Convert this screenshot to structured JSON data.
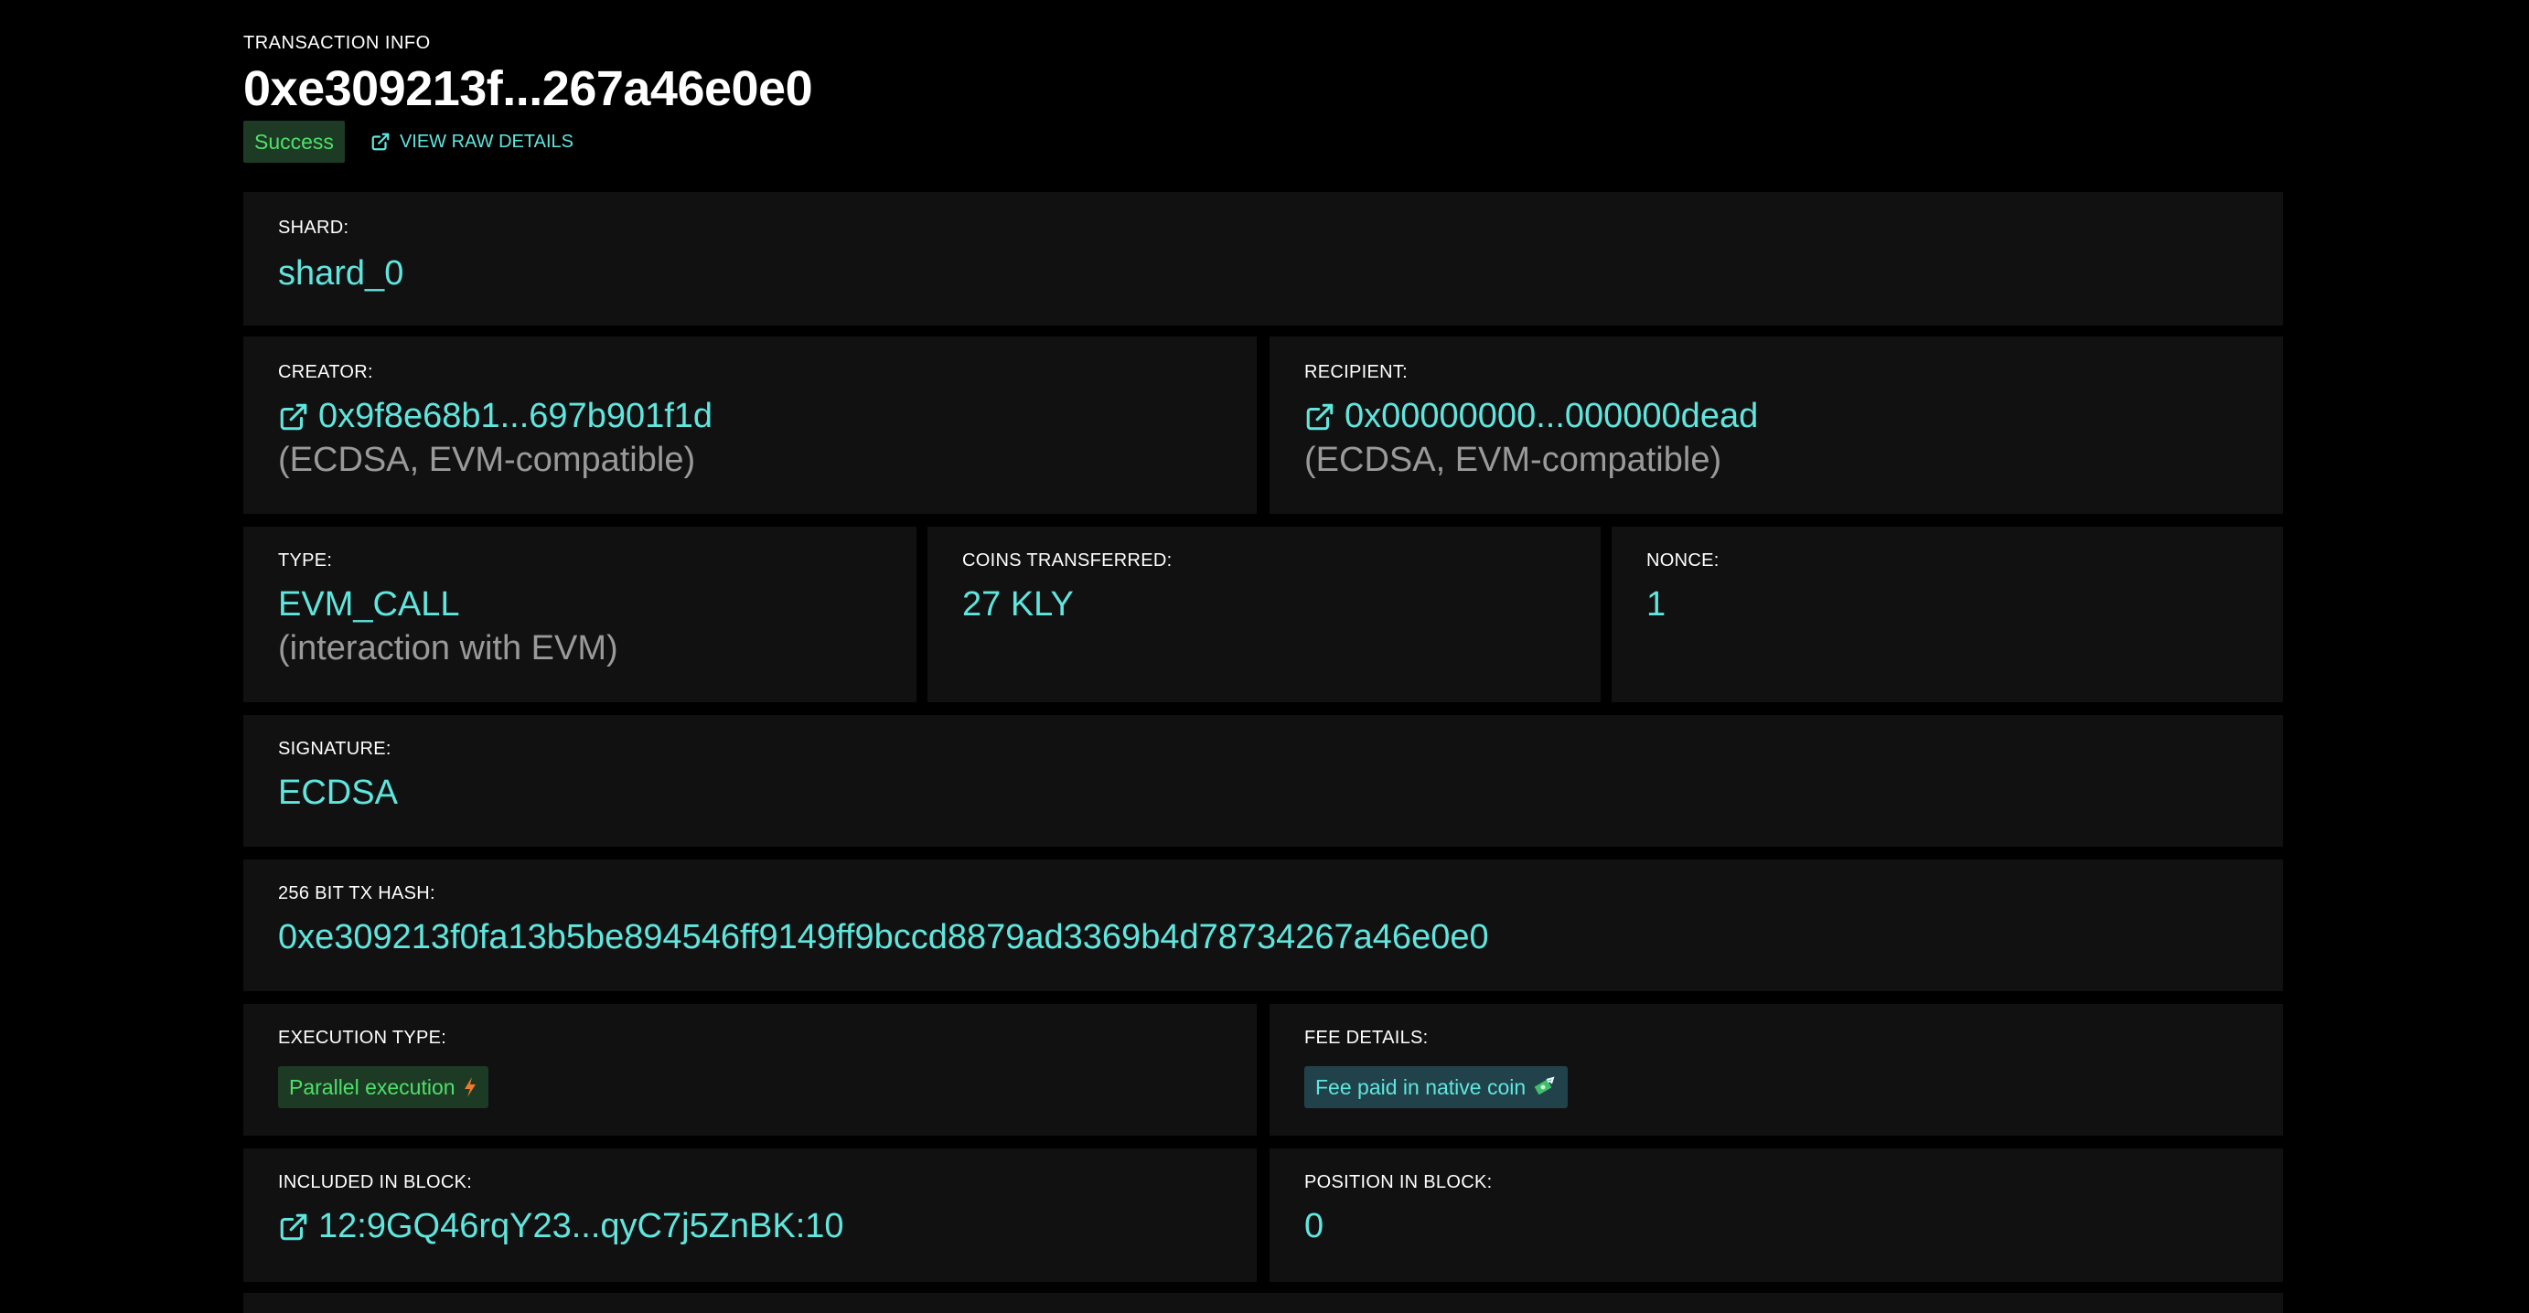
{
  "header": {
    "eyebrow": "TRANSACTION INFO",
    "tx_hash_short": "0xe309213f...267a46e0e0",
    "status": "Success",
    "raw_link": "VIEW RAW DETAILS"
  },
  "shard": {
    "label": "SHARD:",
    "value": "shard_0"
  },
  "creator": {
    "label": "CREATOR:",
    "address": "0x9f8e68b1...697b901f1d",
    "note": "(ECDSA, EVM-compatible)"
  },
  "recipient": {
    "label": "RECIPIENT:",
    "address": "0x00000000...000000dead",
    "note": "(ECDSA, EVM-compatible)"
  },
  "type": {
    "label": "TYPE:",
    "value": "EVM_CALL",
    "note": "(interaction with EVM)"
  },
  "coins": {
    "label": "COINS TRANSFERRED:",
    "value": "27 KLY"
  },
  "nonce": {
    "label": "NONCE:",
    "value": "1"
  },
  "signature": {
    "label": "SIGNATURE:",
    "value": "ECDSA"
  },
  "tx_hash": {
    "label": "256 BIT TX HASH:",
    "value": "0xe309213f0fa13b5be894546ff9149ff9bccd8879ad3369b4d78734267a46e0e0"
  },
  "execution": {
    "label": "EXECUTION TYPE:",
    "value": "Parallel execution",
    "icon": "lightning-icon"
  },
  "fee": {
    "label": "FEE DETAILS:",
    "value": "Fee paid in native coin",
    "icon": "money-icon"
  },
  "block": {
    "label": "INCLUDED IN BLOCK:",
    "value": "12:9GQ46rqY23...qyC7j5ZnBK:10"
  },
  "position": {
    "label": "POSITION IN BLOCK:",
    "value": "0"
  },
  "colors": {
    "background": "#000000",
    "card": "#111111",
    "accent": "#5fe6de",
    "success": "#4ee06a",
    "muted": "#9a9a9a"
  }
}
